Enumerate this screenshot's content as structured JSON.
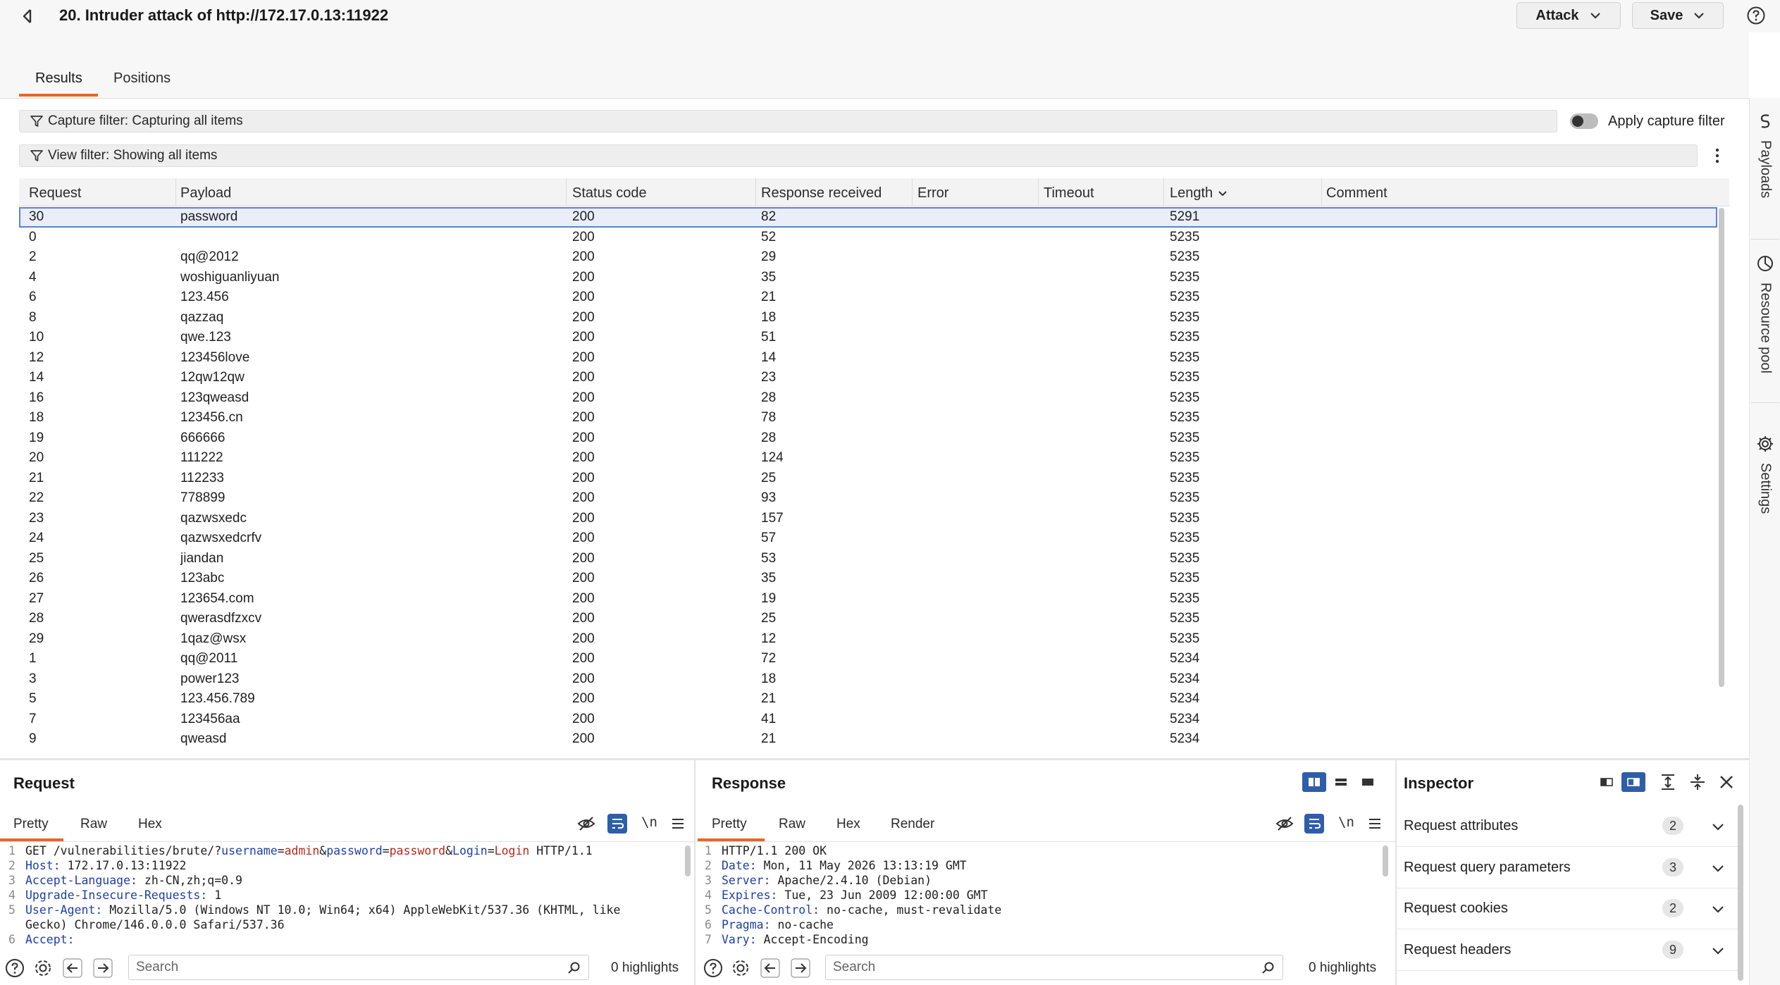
{
  "window": {
    "title": "20. Intruder attack of http://172.17.0.13:11922",
    "attack_label": "Attack",
    "save_label": "Save"
  },
  "tabs": [
    {
      "label": "Results",
      "active": true
    },
    {
      "label": "Positions",
      "active": false
    }
  ],
  "filters": {
    "capture": "Capture filter: Capturing all items",
    "apply_capture_label": "Apply capture filter",
    "apply_capture_on": false,
    "view": "View filter: Showing all items"
  },
  "side_rail": [
    "Payloads",
    "Resource pool",
    "Settings"
  ],
  "table": {
    "columns": [
      "Request",
      "Payload",
      "Status code",
      "Response received",
      "Error",
      "Timeout",
      "Length",
      "Comment"
    ],
    "sorted_by": "Length",
    "selected_row": 0,
    "rows": [
      [
        "30",
        "password",
        "200",
        "82",
        "",
        "",
        "5291",
        ""
      ],
      [
        "0",
        "",
        "200",
        "52",
        "",
        "",
        "5235",
        ""
      ],
      [
        "2",
        "qq@2012",
        "200",
        "29",
        "",
        "",
        "5235",
        ""
      ],
      [
        "4",
        "woshiguanliyuan",
        "200",
        "35",
        "",
        "",
        "5235",
        ""
      ],
      [
        "6",
        "123.456",
        "200",
        "21",
        "",
        "",
        "5235",
        ""
      ],
      [
        "8",
        "qazzaq",
        "200",
        "18",
        "",
        "",
        "5235",
        ""
      ],
      [
        "10",
        "qwe.123",
        "200",
        "51",
        "",
        "",
        "5235",
        ""
      ],
      [
        "12",
        "123456love",
        "200",
        "14",
        "",
        "",
        "5235",
        ""
      ],
      [
        "14",
        "12qw12qw",
        "200",
        "23",
        "",
        "",
        "5235",
        ""
      ],
      [
        "16",
        "123qweasd",
        "200",
        "28",
        "",
        "",
        "5235",
        ""
      ],
      [
        "18",
        "123456.cn",
        "200",
        "78",
        "",
        "",
        "5235",
        ""
      ],
      [
        "19",
        "666666",
        "200",
        "28",
        "",
        "",
        "5235",
        ""
      ],
      [
        "20",
        "111222",
        "200",
        "124",
        "",
        "",
        "5235",
        ""
      ],
      [
        "21",
        "112233",
        "200",
        "25",
        "",
        "",
        "5235",
        ""
      ],
      [
        "22",
        "778899",
        "200",
        "93",
        "",
        "",
        "5235",
        ""
      ],
      [
        "23",
        "qazwsxedc",
        "200",
        "157",
        "",
        "",
        "5235",
        ""
      ],
      [
        "24",
        "qazwsxedcrfv",
        "200",
        "57",
        "",
        "",
        "5235",
        ""
      ],
      [
        "25",
        "jiandan",
        "200",
        "53",
        "",
        "",
        "5235",
        ""
      ],
      [
        "26",
        "123abc",
        "200",
        "35",
        "",
        "",
        "5235",
        ""
      ],
      [
        "27",
        "123654.com",
        "200",
        "19",
        "",
        "",
        "5235",
        ""
      ],
      [
        "28",
        "qwerasdfzxcv",
        "200",
        "25",
        "",
        "",
        "5235",
        ""
      ],
      [
        "29",
        "1qaz@wsx",
        "200",
        "12",
        "",
        "",
        "5235",
        ""
      ],
      [
        "1",
        "qq@2011",
        "200",
        "72",
        "",
        "",
        "5234",
        ""
      ],
      [
        "3",
        "power123",
        "200",
        "18",
        "",
        "",
        "5234",
        ""
      ],
      [
        "5",
        "123.456.789",
        "200",
        "21",
        "",
        "",
        "5234",
        ""
      ],
      [
        "7",
        "123456aa",
        "200",
        "41",
        "",
        "",
        "5234",
        ""
      ],
      [
        "9",
        "qweasd",
        "200",
        "21",
        "",
        "",
        "5234",
        ""
      ]
    ]
  },
  "request": {
    "title": "Request",
    "tabs": [
      "Pretty",
      "Raw",
      "Hex"
    ],
    "newline_toggle": "\\n",
    "lines": [
      {
        "n": "1",
        "parts": [
          [
            "plain",
            "GET /vulnerabilities/brute/?"
          ],
          [
            "blue",
            "username"
          ],
          [
            "plain",
            "="
          ],
          [
            "red",
            "admin"
          ],
          [
            "plain",
            "&"
          ],
          [
            "blue",
            "password"
          ],
          [
            "plain",
            "="
          ],
          [
            "red",
            "password"
          ],
          [
            "plain",
            "&"
          ],
          [
            "blue",
            "Login"
          ],
          [
            "plain",
            "="
          ],
          [
            "red",
            "Login"
          ],
          [
            "plain",
            " HTTP/1.1"
          ]
        ]
      },
      {
        "n": "2",
        "parts": [
          [
            "blue",
            "Host:"
          ],
          [
            "plain",
            " 172.17.0.13:11922"
          ]
        ]
      },
      {
        "n": "3",
        "parts": [
          [
            "blue",
            "Accept-Language:"
          ],
          [
            "plain",
            " zh-CN,zh;q=0.9"
          ]
        ]
      },
      {
        "n": "4",
        "parts": [
          [
            "blue",
            "Upgrade-Insecure-Requests:"
          ],
          [
            "plain",
            " 1"
          ]
        ]
      },
      {
        "n": "5",
        "parts": [
          [
            "blue",
            "User-Agent:"
          ],
          [
            "plain",
            " Mozilla/5.0 (Windows NT 10.0; Win64; x64) AppleWebKit/537.36 (KHTML, like"
          ]
        ]
      },
      {
        "n": "",
        "parts": [
          [
            "plain",
            "Gecko) Chrome/146.0.0.0 Safari/537.36"
          ]
        ]
      },
      {
        "n": "6",
        "parts": [
          [
            "blue",
            "Accept:"
          ]
        ]
      }
    ],
    "search_placeholder": "Search",
    "highlights": "0 highlights"
  },
  "response": {
    "title": "Response",
    "tabs": [
      "Pretty",
      "Raw",
      "Hex",
      "Render"
    ],
    "newline_toggle": "\\n",
    "lines": [
      {
        "n": "1",
        "parts": [
          [
            "plain",
            "HTTP/1.1 200 OK"
          ]
        ]
      },
      {
        "n": "2",
        "parts": [
          [
            "blue",
            "Date:"
          ],
          [
            "plain",
            " Mon, 11 May 2026 13:13:19 GMT"
          ]
        ]
      },
      {
        "n": "3",
        "parts": [
          [
            "blue",
            "Server:"
          ],
          [
            "plain",
            " Apache/2.4.10 (Debian)"
          ]
        ]
      },
      {
        "n": "4",
        "parts": [
          [
            "blue",
            "Expires:"
          ],
          [
            "plain",
            " Tue, 23 Jun 2009 12:00:00 GMT"
          ]
        ]
      },
      {
        "n": "5",
        "parts": [
          [
            "blue",
            "Cache-Control:"
          ],
          [
            "plain",
            " no-cache, must-revalidate"
          ]
        ]
      },
      {
        "n": "6",
        "parts": [
          [
            "blue",
            "Pragma:"
          ],
          [
            "plain",
            " no-cache"
          ]
        ]
      },
      {
        "n": "7",
        "parts": [
          [
            "blue",
            "Vary:"
          ],
          [
            "plain",
            " Accept-Encoding"
          ]
        ]
      }
    ],
    "search_placeholder": "Search",
    "highlights": "0 highlights"
  },
  "inspector": {
    "title": "Inspector",
    "sections": [
      {
        "label": "Request attributes",
        "count": "2"
      },
      {
        "label": "Request query parameters",
        "count": "3"
      },
      {
        "label": "Request cookies",
        "count": "2"
      },
      {
        "label": "Request headers",
        "count": "9"
      }
    ]
  },
  "colors": {
    "accent_orange": "#e8652b",
    "toggle_blue": "#2f5ea8",
    "selection_border": "#5b83cf",
    "code_key_blue": "#1f3fa8",
    "code_value_red": "#b8281a"
  }
}
